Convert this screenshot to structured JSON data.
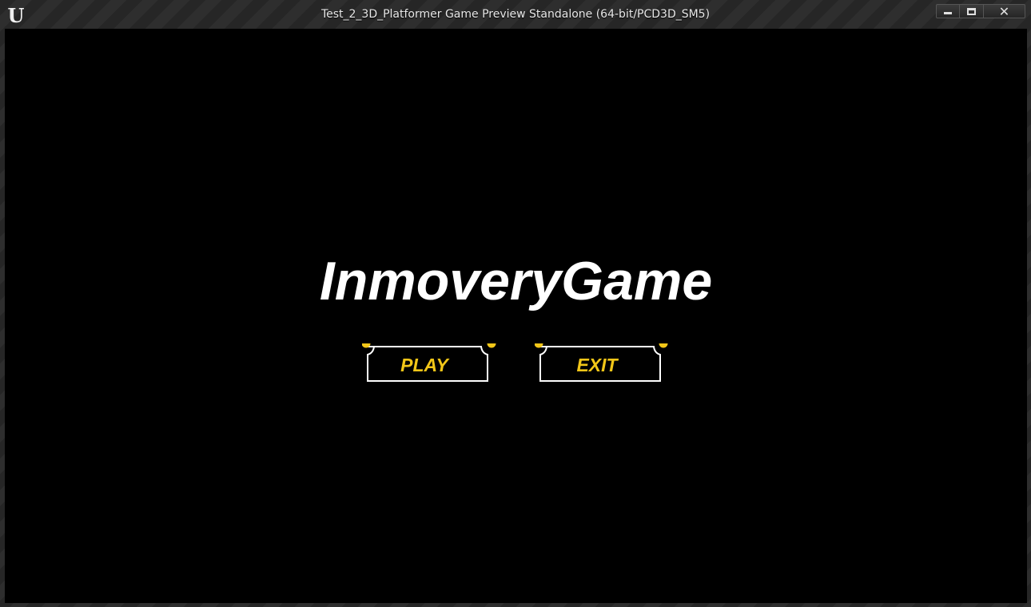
{
  "window": {
    "title": "Test_2_3D_Platformer Game Preview Standalone (64-bit/PCD3D_SM5)",
    "logo": "U",
    "controls": {
      "minimize_icon": "minimize-icon",
      "maximize_icon": "maximize-icon",
      "close_glyph": "✕"
    }
  },
  "game": {
    "title": "InmoveryGame",
    "menu": {
      "play_label": "PLAY",
      "exit_label": "EXIT"
    }
  },
  "colors": {
    "accent": "#f2c618",
    "button_outline": "#ffffff",
    "background": "#000000"
  }
}
